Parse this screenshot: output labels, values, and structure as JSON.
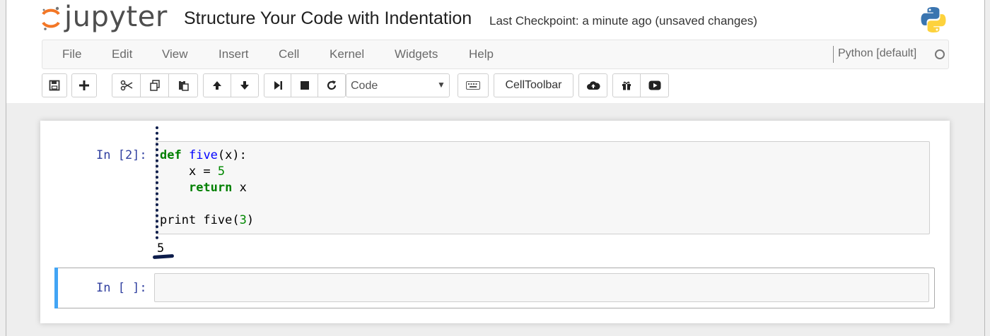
{
  "header": {
    "logo_text": "jupyter",
    "notebook_title": "Structure Your Code with Indentation",
    "checkpoint": "Last Checkpoint: a minute ago (unsaved changes)",
    "python_logo_icon": "python-logo-icon"
  },
  "menubar": {
    "items": [
      "File",
      "Edit",
      "View",
      "Insert",
      "Cell",
      "Kernel",
      "Widgets",
      "Help"
    ],
    "kernel_name": "Python [default]"
  },
  "toolbar": {
    "cell_type": "Code",
    "celltoolbar_label": "CellToolbar",
    "icons": [
      "save-icon",
      "plus-icon",
      "cut-icon",
      "copy-icon",
      "paste-icon",
      "arrow-up-icon",
      "arrow-down-icon",
      "step-forward-icon",
      "stop-icon",
      "refresh-icon",
      "keyboard-icon",
      "cloud-upload-icon",
      "gift-icon",
      "play-circle-icon"
    ]
  },
  "cells": [
    {
      "prompt": "In [2]:",
      "code": {
        "line1": {
          "kw": "def",
          "name": "five",
          "rest": "(x):"
        },
        "line2": {
          "indent": "    ",
          "text": "x = ",
          "num": "5"
        },
        "line3": {
          "indent": "    ",
          "kw": "return",
          "rest": " x"
        },
        "line5": {
          "name": "print five(",
          "num": "3",
          "rest": ")"
        }
      },
      "output": "5"
    },
    {
      "prompt": "In [ ]:",
      "code": ""
    }
  ],
  "colors": {
    "prompt": "#303f9f",
    "keyword": "#008000",
    "function_name": "#0000ff",
    "number": "#008800",
    "selected_cell_bar": "#42a5f5",
    "annotation_ink": "#0c1c4a"
  }
}
